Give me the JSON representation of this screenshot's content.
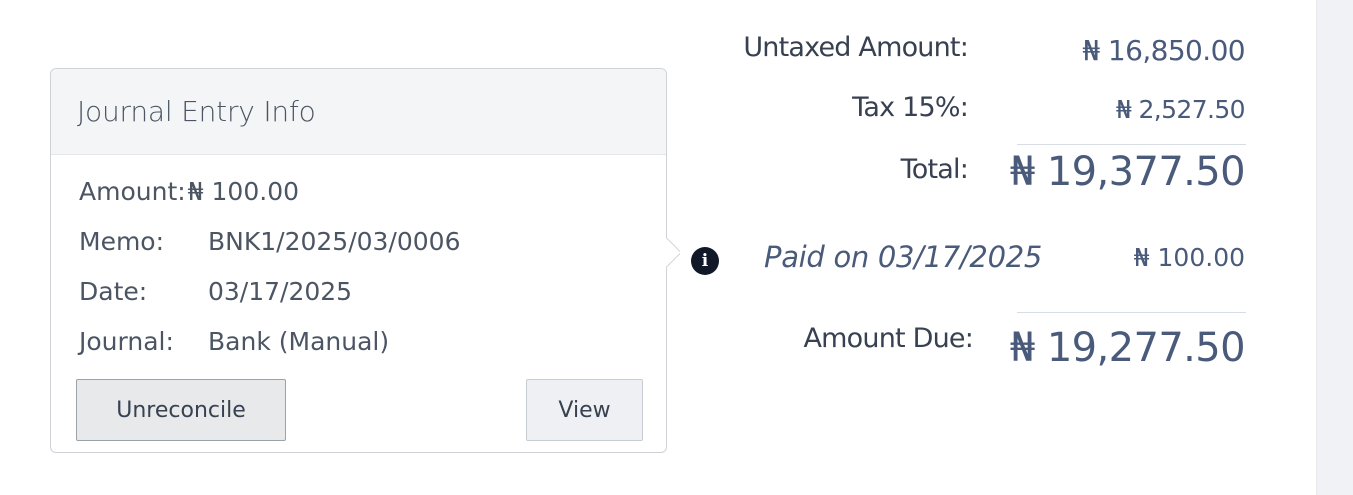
{
  "journal_entry": {
    "title": "Journal Entry Info",
    "rows": [
      {
        "label": "Amount:",
        "value": "₦ 100.00"
      },
      {
        "label": "Memo:",
        "value": "BNK1/2025/03/0006"
      },
      {
        "label": "Date:",
        "value": "03/17/2025"
      },
      {
        "label": "Journal:",
        "value": "Bank (Manual)"
      }
    ],
    "unreconcile_label": "Unreconcile",
    "view_label": "View"
  },
  "totals": {
    "untaxed_label": "Untaxed Amount:",
    "untaxed_value": "₦ 16,850.00",
    "tax_label": "Tax 15%:",
    "tax_value": "₦ 2,527.50",
    "total_label": "Total:",
    "total_value": "₦ 19,377.50",
    "paid_on": "Paid on 03/17/2025",
    "paid_amount": "₦ 100.00",
    "amount_due_label": "Amount Due:",
    "amount_due_value": "₦ 19,277.50"
  },
  "icons": {
    "payment_info": "info-circle-icon"
  }
}
